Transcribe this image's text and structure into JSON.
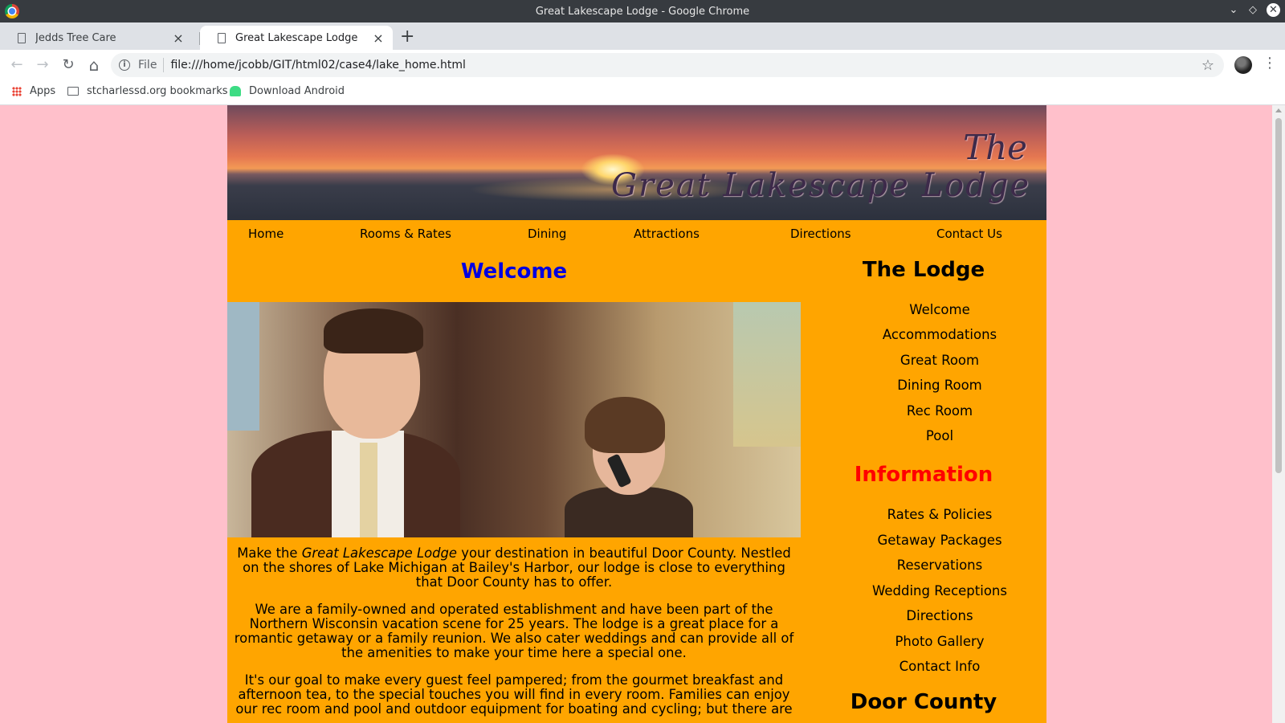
{
  "window": {
    "title": "Great Lakescape Lodge - Google Chrome",
    "controls": [
      "⌄",
      "◇",
      "✕"
    ]
  },
  "tabs": [
    {
      "title": "Jedds Tree Care",
      "active": false
    },
    {
      "title": "Great Lakescape Lodge",
      "active": true
    }
  ],
  "toolbar": {
    "back_icon": "←",
    "forward_icon": "→",
    "reload_icon": "↻",
    "home_icon": "⌂",
    "file_label": "File",
    "url": "file:///home/jcobb/GIT/html02/case4/lake_home.html"
  },
  "bookmarks": [
    {
      "label": "Apps",
      "icon": "apps-grid-icon"
    },
    {
      "label": "stcharlessd.org bookmarks",
      "icon": "folder-icon"
    },
    {
      "label": "Download Android",
      "icon": "android-icon"
    }
  ],
  "site": {
    "logo": {
      "line1": "The",
      "line2": "Great Lakescape Lodge"
    },
    "nav": [
      "Home",
      "Rooms & Rates",
      "Dining",
      "Attractions",
      "Directions",
      "Contact Us"
    ],
    "welcome_heading": "Welcome",
    "paragraphs": {
      "p1_before": "Make the ",
      "p1_em": "Great Lakescape Lodge",
      "p1_after": " your destination in beautiful Door County. Nestled on the shores of Lake Michigan at Bailey's Harbor, our lodge is close to everything that Door County has to offer.",
      "p2": "We are a family-owned and operated establishment and have been part of the Northern Wisconsin vacation scene for 25 years. The lodge is a great place for a romantic getaway or a family reunion. We also cater weddings and can provide all of the amenities to make your time here a special one.",
      "p3": "It's our goal to make every guest feel pampered; from the gourmet breakfast and afternoon tea, to the special touches you will find in every room. Families can enjoy our rec room and pool and outdoor equipment for boating and cycling; but there are"
    },
    "sidebar": {
      "lodge_heading": "The Lodge",
      "lodge_links": [
        "Welcome",
        "Accommodations",
        "Great Room",
        "Dining Room",
        "Rec Room",
        "Pool"
      ],
      "info_heading": "Information",
      "info_links": [
        "Rates & Policies",
        "Getaway Packages",
        "Reservations",
        "Wedding Receptions",
        "Directions",
        "Photo Gallery",
        "Contact Info"
      ],
      "door_heading": "Door County"
    },
    "colors": {
      "page_bg": "#ffc0cb",
      "content_bg": "#ffa500",
      "welcome": "#0000e0",
      "info_heading": "#ff0000"
    }
  }
}
